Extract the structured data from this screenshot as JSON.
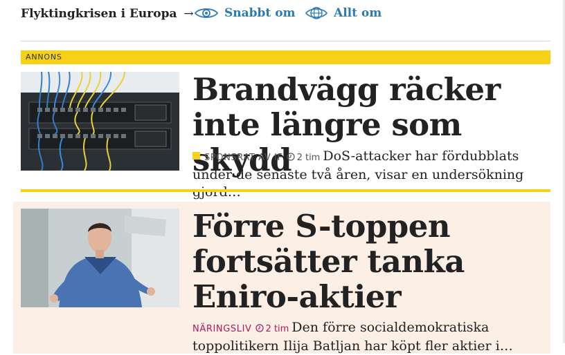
{
  "nav": {
    "topic": "Flyktingkrisen i Europa",
    "topic_arrow": "→",
    "quick_label": "Snabbt om",
    "all_label": "Allt om"
  },
  "ad": {
    "label": "ANNONS",
    "headline": "Brandvägg räcker inte längre som skydd",
    "sponsor": "SPONSRAT AV IF",
    "time": "2 tim",
    "teaser": "DoS-attacker har fördubblats under de senaste två åren, visar en undersökning gjord…"
  },
  "featured": {
    "headline": "Förre S-toppen fortsätter tanka Eniro-aktier",
    "section": "NÄRINGSLIV",
    "time": "2 tim",
    "teaser": "Den förre socialdemokratiska toppolitikern Ilija Batljan har köpt fler aktier i…"
  },
  "colors": {
    "link_blue": "#2a7ab5",
    "ad_yellow": "#f7d117",
    "section_red": "#b2175c",
    "featured_bg": "#fcefe6"
  },
  "icons": [
    "eye-icon",
    "globe-icon",
    "clock-icon",
    "arrow-right-icon"
  ]
}
